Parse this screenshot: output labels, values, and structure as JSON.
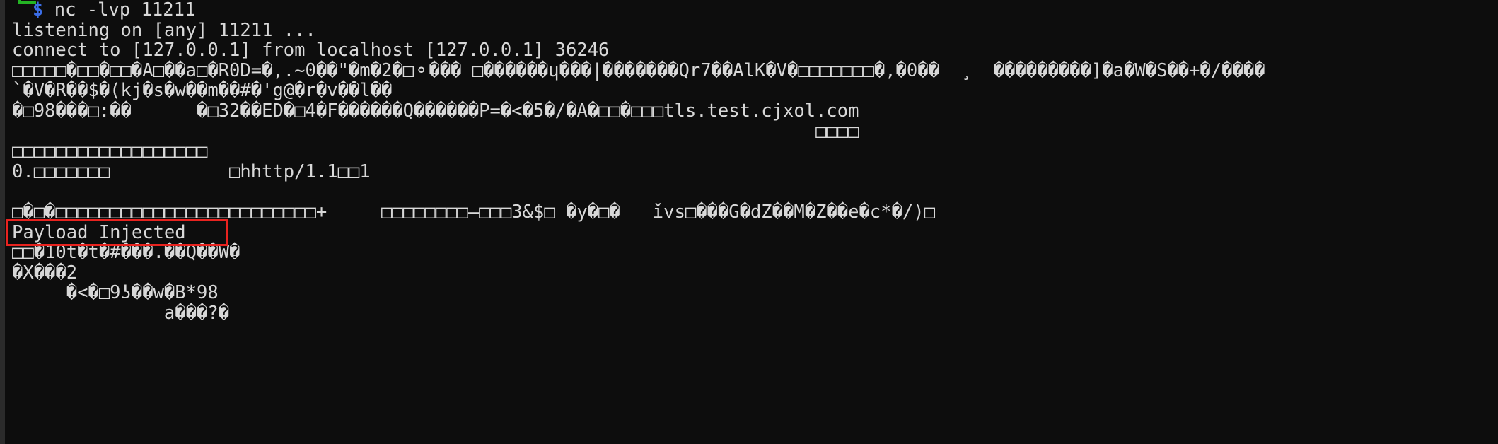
{
  "terminal": {
    "window_title": "nc -lvp 11211",
    "colors": {
      "background": "#0d0d0d",
      "foreground": "#d8d8d8",
      "prompt_bracket_green": "#24b324",
      "prompt_dollar_blue": "#3b6ee8",
      "annotation_red": "#e8231f",
      "gutter": "#2b2b2b"
    },
    "prompt": {
      "corner_glyph": "corner-bracket-icon",
      "symbol": "$",
      "command": "nc -lvp 11211"
    },
    "lines": [
      {
        "id": "listening",
        "text": "listening on [any] 11211 ..."
      },
      {
        "id": "connect",
        "text": "connect to [127.0.0.1] from localhost [127.0.0.1] 36246"
      },
      {
        "id": "binary-1",
        "text": "□□□□□�□□�□□�A□��a□�R0D=�,.~0��\"�m�2�□⚬��� □������ɥ���|�������Qr7��AlK�V�□□□□□□□�,�0��  ¸  ���������]�a�W�S��+�/����"
      },
      {
        "id": "binary-2",
        "text": "`�V�R��$�(kj�s�w��m��#�'g@�r�v��l��"
      },
      {
        "id": "binary-3-hostname",
        "text": "�□98���□:��      �□32��ED�□4�F������Q������P=�<�5�/�A�□□�□□□tls.test.cjxol.com"
      },
      {
        "id": "binary-4-right",
        "text": "                                                                          □□□□"
      },
      {
        "id": "binary-5-boxes",
        "text": "□□□□□□□□□□□□□□□□□□"
      },
      {
        "id": "binary-6-http",
        "text": "0.□□□□□□□           □hhttp/1.1□□1"
      },
      {
        "id": "blank-1",
        "text": ""
      },
      {
        "id": "binary-7",
        "text": "□�□�□□□□□□□□□□□□□□□□□□□□□□□□+     □□□□□□□□–□□□3&$□ �y�□�   ǐvs□���G�dZ��M�Z��e�c*�/)□"
      },
      {
        "id": "payload-injected",
        "text": "Payload Injected",
        "highlighted": true
      },
      {
        "id": "binary-8",
        "text": "□□�10t�t�#���.��Q��W�"
      },
      {
        "id": "binary-9",
        "text": "�X���2"
      },
      {
        "id": "binary-10",
        "text": "     �<�□9ʖ��w�B*98"
      },
      {
        "id": "binary-11",
        "text": "              a���?�"
      }
    ],
    "annotation": {
      "label": "payload-injected-highlight",
      "target_text": "Payload Injected",
      "border_color": "#e8231f"
    }
  }
}
